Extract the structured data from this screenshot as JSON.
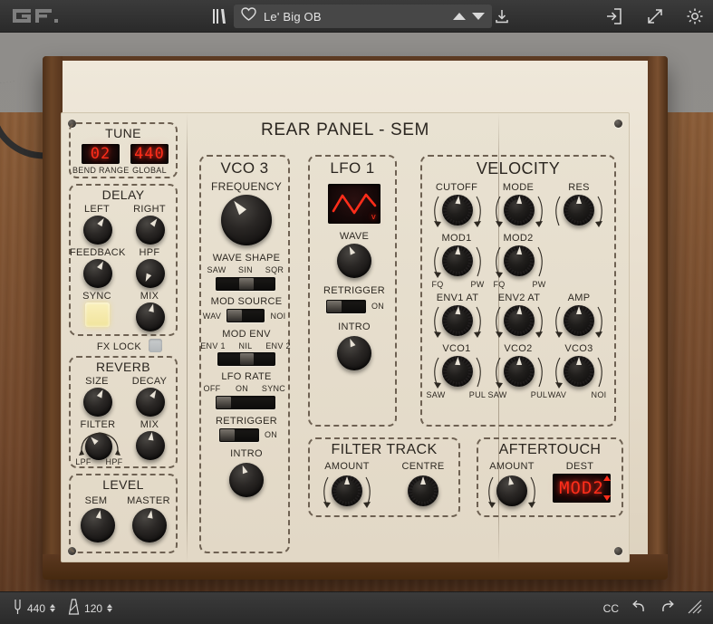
{
  "app": {
    "logo_text": "GF.",
    "panel_title": "REAR PANEL - SEM"
  },
  "topbar": {
    "browser_icon": "library-icon",
    "favorite_icon": "heart-icon",
    "preset_name": "Le' Big OB",
    "prev_icon": "triangle-up-icon",
    "next_icon": "triangle-down-icon",
    "download_icon": "download-icon",
    "midi_icon": "midi-learn-icon",
    "resize_icon": "expand-icon",
    "settings_icon": "gear-icon"
  },
  "bottombar": {
    "tuning_icon": "tuning-fork-icon",
    "tuning_value": "440",
    "tempo_icon": "metronome-icon",
    "tempo_value": "120",
    "cc_label": "CC",
    "undo_icon": "undo-icon",
    "redo_icon": "redo-icon",
    "resize_grip_icon": "resize-grip-icon"
  },
  "tune": {
    "title": "TUNE",
    "bend_range_value": "02",
    "bend_range_label": "BEND RANGE",
    "global_value": "440",
    "global_label": "GLOBAL"
  },
  "delay": {
    "title": "DELAY",
    "knobs": [
      {
        "label": "LEFT"
      },
      {
        "label": "RIGHT"
      },
      {
        "label": "FEEDBACK"
      },
      {
        "label": "HPF"
      },
      {
        "label": "MIX"
      }
    ],
    "sync_label": "SYNC",
    "sync_state": "on"
  },
  "fx_lock": {
    "label": "FX LOCK",
    "state": "off"
  },
  "reverb": {
    "title": "REVERB",
    "knobs": [
      {
        "label": "SIZE"
      },
      {
        "label": "DECAY"
      },
      {
        "label": "FILTER"
      },
      {
        "label": "MIX"
      }
    ],
    "filter_min": "LPF",
    "filter_max": "HPF"
  },
  "level": {
    "title": "LEVEL",
    "knobs": [
      {
        "label": "SEM"
      },
      {
        "label": "MASTER"
      }
    ]
  },
  "vco3": {
    "title": "VCO 3",
    "frequency_label": "FREQUENCY",
    "wave_shape_label": "WAVE SHAPE",
    "wave_shape_options": [
      "SAW",
      "SIN",
      "SQR"
    ],
    "wave_shape_selected": "SIN",
    "mod_source_label": "MOD SOURCE",
    "mod_source_options": [
      "WAV",
      "NOI"
    ],
    "mod_source_selected": "WAV",
    "mod_env_label": "MOD ENV",
    "mod_env_options": [
      "ENV 1",
      "NIL",
      "ENV 2"
    ],
    "mod_env_selected": "NIL",
    "lfo_rate_label": "LFO RATE",
    "lfo_rate_options": [
      "OFF",
      "ON",
      "SYNC"
    ],
    "lfo_rate_selected": "OFF",
    "retrigger_label": "RETRIGGER",
    "retrigger_on_label": "ON",
    "retrigger_state": "off",
    "intro_label": "INTRO"
  },
  "lfo1": {
    "title": "LFO 1",
    "display_icon": "triangle-wave-icon",
    "display_marker": "v",
    "wave_label": "WAVE",
    "retrigger_label": "RETRIGGER",
    "retrigger_on_label": "ON",
    "retrigger_state": "off",
    "intro_label": "INTRO"
  },
  "velocity": {
    "title": "VELOCITY",
    "rows": [
      [
        {
          "label": "CUTOFF",
          "min": "",
          "max": ""
        },
        {
          "label": "MODE",
          "min": "",
          "max": ""
        },
        {
          "label": "RES",
          "min": "",
          "max": ""
        }
      ],
      [
        {
          "label": "MOD1",
          "min": "FQ",
          "max": "PW"
        },
        {
          "label": "MOD2",
          "min": "FQ",
          "max": "PW"
        }
      ],
      [
        {
          "label": "ENV1 AT",
          "min": "",
          "max": ""
        },
        {
          "label": "ENV2 AT",
          "min": "",
          "max": ""
        },
        {
          "label": "AMP",
          "min": "",
          "max": ""
        }
      ],
      [
        {
          "label": "VCO1",
          "min": "SAW",
          "max": "PUL"
        },
        {
          "label": "VCO2",
          "min": "SAW",
          "max": "PUL"
        },
        {
          "label": "VCO3",
          "min": "WAV",
          "max": "NOI"
        }
      ]
    ]
  },
  "filter_track": {
    "title": "FILTER TRACK",
    "knobs": [
      {
        "label": "AMOUNT"
      },
      {
        "label": "CENTRE"
      }
    ]
  },
  "aftertouch": {
    "title": "AFTERTOUCH",
    "amount_label": "AMOUNT",
    "dest_label": "DEST",
    "dest_value": "MOD2",
    "dest_up_icon": "caret-up-icon",
    "dest_down_icon": "caret-down-icon"
  },
  "colors": {
    "led_red": "#ff2d1a",
    "panel_cream": "#e9e2d2",
    "wood": "#6b4527",
    "pad_on": "#f5e9ab"
  }
}
